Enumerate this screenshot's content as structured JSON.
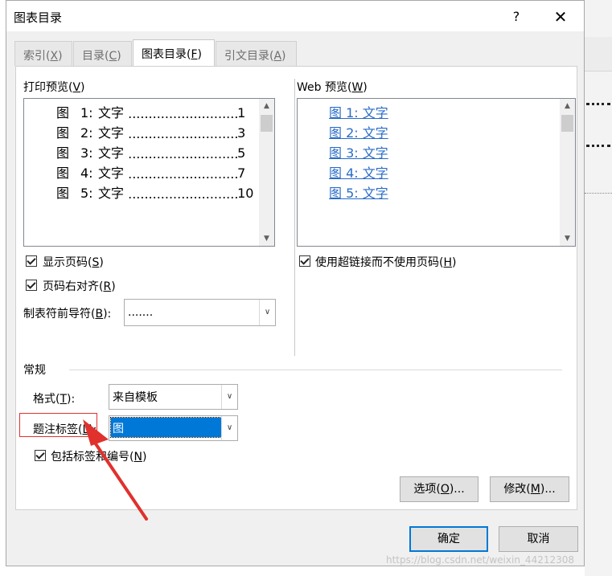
{
  "window": {
    "title": "图表目录",
    "help_label": "?",
    "close_label": "✕"
  },
  "tabs": [
    {
      "label": "索引(",
      "key": "X",
      "suffix": ")"
    },
    {
      "label": "目录(",
      "key": "C",
      "suffix": ")"
    },
    {
      "label": "图表目录(",
      "key": "F",
      "suffix": ")"
    },
    {
      "label": "引文目录(",
      "key": "A",
      "suffix": ")"
    }
  ],
  "print_preview": {
    "label": "打印预览(",
    "key": "V",
    "suffix": ")",
    "entries": [
      {
        "fig": "图",
        "num": "1:",
        "text": "文字",
        "dots": "................................................",
        "page": "1"
      },
      {
        "fig": "图",
        "num": "2:",
        "text": "文字",
        "dots": "................................................",
        "page": "3"
      },
      {
        "fig": "图",
        "num": "3:",
        "text": "文字",
        "dots": "................................................",
        "page": "5"
      },
      {
        "fig": "图",
        "num": "4:",
        "text": "文字",
        "dots": "................................................",
        "page": "7"
      },
      {
        "fig": "图",
        "num": "5:",
        "text": "文字",
        "dots": "................................................",
        "page": "10"
      }
    ]
  },
  "web_preview": {
    "label": "Web 预览(",
    "key": "W",
    "suffix": ")",
    "entries": [
      "图 1: 文字",
      "图 2: 文字",
      "图 3: 文字",
      "图 4: 文字",
      "图 5: 文字"
    ]
  },
  "options": {
    "show_page_numbers": {
      "label": "显示页码(",
      "key": "S",
      "suffix": ")",
      "checked": true
    },
    "right_align": {
      "label": "页码右对齐(",
      "key": "R",
      "suffix": ")",
      "checked": true
    },
    "tab_leader": {
      "label": "制表符前导符(",
      "key": "B",
      "suffix": "):",
      "value": "......."
    },
    "use_hyperlinks": {
      "label": "使用超链接而不使用页码(",
      "key": "H",
      "suffix": ")",
      "checked": true
    }
  },
  "general": {
    "heading": "常规",
    "format": {
      "label": "格式(",
      "key": "T",
      "suffix": "):",
      "value": "来自模板"
    },
    "caption_label": {
      "label": "题注标签(",
      "key": "L",
      "suffix": "):",
      "value": "图"
    },
    "include_label": {
      "label": "包括标签和编号(",
      "key": "N",
      "suffix": ")",
      "checked": true
    }
  },
  "buttons": {
    "options": {
      "label": "选项(",
      "key": "O",
      "suffix": ")..."
    },
    "modify": {
      "label": "修改(",
      "key": "M",
      "suffix": ")..."
    },
    "ok": "确定",
    "cancel": "取消"
  },
  "watermark": "https://blog.csdn.net/weixin_44212308",
  "colors": {
    "accent": "#0078d7",
    "link": "#2a6cc7",
    "annotation": "#e0312d"
  }
}
